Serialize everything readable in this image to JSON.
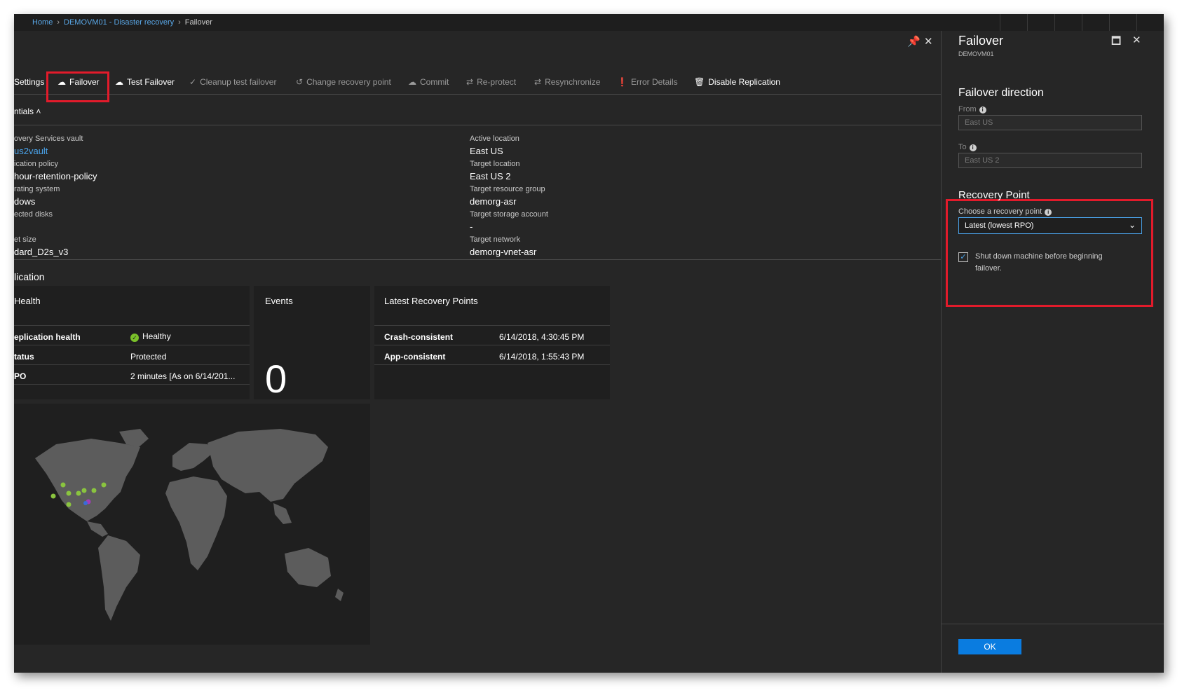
{
  "breadcrumb": {
    "home": "Home",
    "parent": "DEMOVM01 - Disaster recovery",
    "current": "Failover"
  },
  "main": {
    "controls": {
      "pin_icon": "pin-icon",
      "close_icon": "close-icon"
    },
    "toolbar": {
      "settings": "Settings",
      "failover": "Failover",
      "test_failover": "Test Failover",
      "cleanup": "Cleanup test failover",
      "change_rp": "Change recovery point",
      "commit": "Commit",
      "reprotect": "Re-protect",
      "resync": "Resynchronize",
      "error_details": "Error Details",
      "disable_replication": "Disable Replication"
    },
    "essentials_label": "ntials",
    "essentials_left": [
      {
        "label": "overy Services vault",
        "value": "us2vault"
      },
      {
        "label": "ication policy",
        "value": "hour-retention-policy"
      },
      {
        "label": "rating system",
        "value": "dows"
      },
      {
        "label": "ected disks",
        "value": ""
      },
      {
        "label": "et size",
        "value": "dard_D2s_v3"
      }
    ],
    "essentials_right": [
      {
        "label": "Active location",
        "value": "East US"
      },
      {
        "label": "Target location",
        "value": "East US 2"
      },
      {
        "label": "Target resource group",
        "value": "demorg-asr"
      },
      {
        "label": "Target storage account",
        "value": "-"
      },
      {
        "label": "Target network",
        "value": "demorg-vnet-asr"
      }
    ],
    "section_title": "lication",
    "health_card": {
      "title": "Health",
      "rows": [
        {
          "label": "eplication health",
          "value": "Healthy"
        },
        {
          "label": "tatus",
          "value": "Protected"
        },
        {
          "label": "PO",
          "value": "2 minutes [As on 6/14/201..."
        }
      ]
    },
    "events_card": {
      "title": "Events",
      "count": "0"
    },
    "recovery_card": {
      "title": "Latest Recovery Points",
      "rows": [
        {
          "label": "Crash-consistent",
          "value": "6/14/2018, 4:30:45 PM"
        },
        {
          "label": "App-consistent",
          "value": "6/14/2018, 1:55:43 PM"
        }
      ]
    },
    "map": {
      "land_color": "#5c5c5c",
      "marker_color": "#8ac43f",
      "target_marker_color": "#a23cb8"
    }
  },
  "side": {
    "title": "Failover",
    "subtitle": "DEMOVM01",
    "direction_heading": "Failover direction",
    "from_label": "From",
    "from_value": "East US",
    "to_label": "To",
    "to_value": "East US 2",
    "rp_heading": "Recovery Point",
    "rp_label": "Choose a recovery point",
    "rp_selected": "Latest (lowest RPO)",
    "shutdown_label": "Shut down machine before beginning failover.",
    "shutdown_checked": true,
    "ok_label": "OK"
  },
  "colors": {
    "accent": "#0a7ce0",
    "highlight": "#e21b2b",
    "link": "#4aa3ea",
    "healthy": "#7bc22a"
  }
}
